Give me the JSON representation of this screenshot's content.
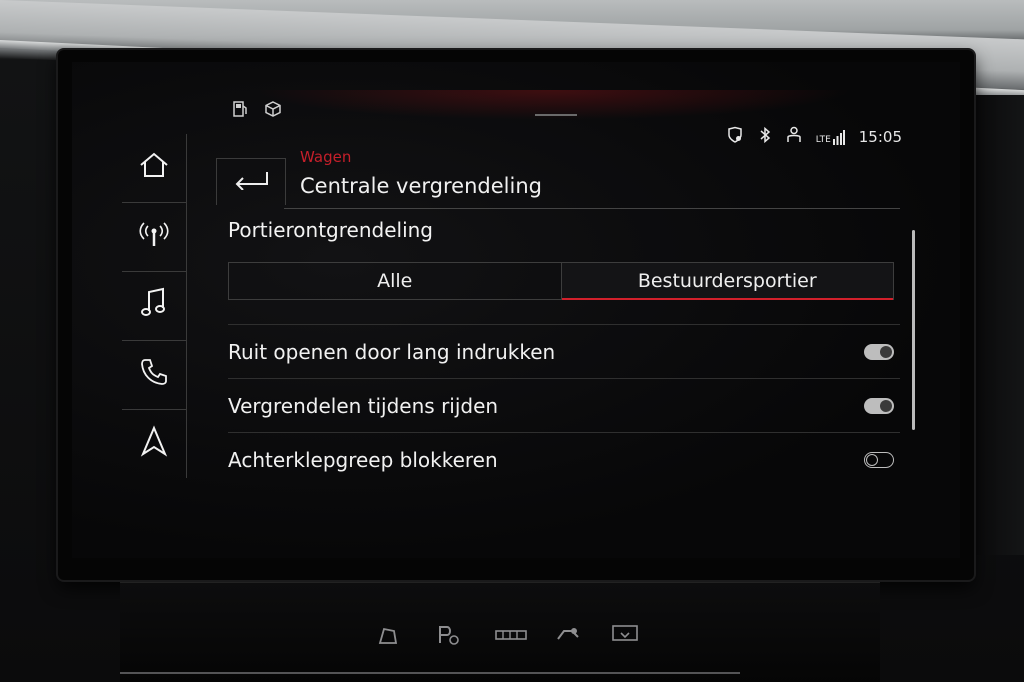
{
  "status_bar": {
    "left_icons": [
      "fuel-pump-icon",
      "package-icon"
    ],
    "right_icons": [
      "location-shield-icon",
      "bluetooth-icon",
      "person-icon",
      "signal-lte-icon"
    ],
    "lte_label": "LTE",
    "time": "15:05"
  },
  "sidebar": {
    "items": [
      {
        "icon": "home-icon"
      },
      {
        "icon": "radio-icon"
      },
      {
        "icon": "music-note-icon"
      },
      {
        "icon": "phone-icon"
      },
      {
        "icon": "navigation-icon"
      }
    ]
  },
  "header": {
    "breadcrumb": "Wagen",
    "title": "Centrale vergrendeling"
  },
  "section": {
    "label": "Portierontgrendeling",
    "options": [
      "Alle",
      "Bestuurdersportier"
    ],
    "selected": "Bestuurdersportier"
  },
  "settings": [
    {
      "label": "Ruit openen door lang indrukken",
      "enabled": true
    },
    {
      "label": "Vergrendelen tijdens rijden",
      "enabled": true
    },
    {
      "label": "Achterklepgreep blokkeren",
      "enabled": false
    }
  ],
  "colors": {
    "accent": "#d2202b",
    "text": "#f1f1f1",
    "background": "#070708"
  }
}
